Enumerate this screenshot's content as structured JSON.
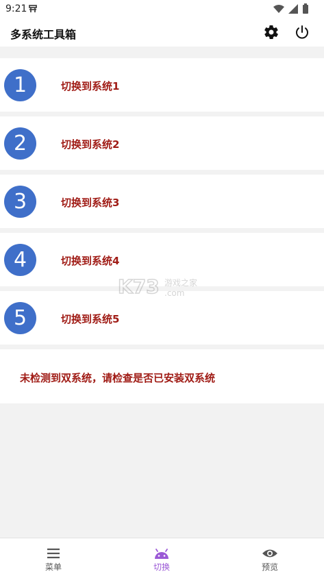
{
  "status": {
    "time": "9:21"
  },
  "app": {
    "title": "多系统工具箱"
  },
  "items": [
    {
      "number": "1",
      "label": "切换到系统1"
    },
    {
      "number": "2",
      "label": "切换到系统2"
    },
    {
      "number": "3",
      "label": "切换到系统3"
    },
    {
      "number": "4",
      "label": "切换到系统4"
    },
    {
      "number": "5",
      "label": "切换到系统5"
    }
  ],
  "notice": "未检测到双系统，请检查是否已安装双系统",
  "watermark": {
    "brand": "K73",
    "text": "游戏之家",
    "domain": ".com"
  },
  "nav": [
    {
      "label": "菜单",
      "icon": "menu-icon"
    },
    {
      "label": "切换",
      "icon": "android-icon",
      "active": true
    },
    {
      "label": "预览",
      "icon": "eye-icon"
    }
  ],
  "colors": {
    "accent": "#3f6fc9",
    "label": "#a01c16",
    "active_nav": "#9b59d6"
  }
}
